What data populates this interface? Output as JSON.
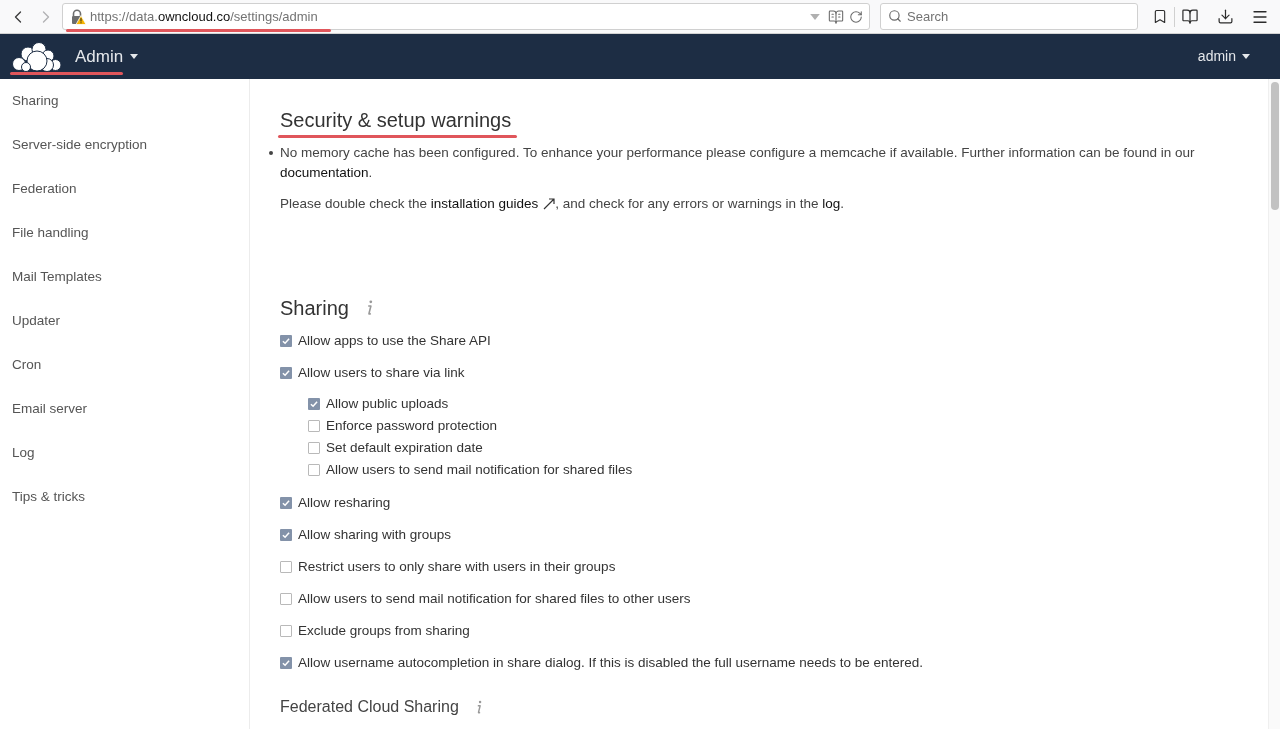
{
  "browser": {
    "navigation": [
      {
        "kind": "back",
        "disabled": false
      },
      {
        "kind": "forward",
        "disabled": true
      }
    ],
    "url": "https://data.**owncloud.co**/settings/admin",
    "search": {
      "placeholder": "Search"
    }
  },
  "header": {
    "app_name": "Admin",
    "user": "admin"
  },
  "sidebar": {
    "items": [
      {
        "label": "Sharing"
      },
      {
        "label": "Server-side encryption"
      },
      {
        "label": "Federation"
      },
      {
        "label": "File handling"
      },
      {
        "label": "Mail Templates"
      },
      {
        "label": "Updater"
      },
      {
        "label": "Cron"
      },
      {
        "label": "Email server"
      },
      {
        "label": "Log"
      },
      {
        "label": "Tips & tricks"
      }
    ]
  },
  "warnings": {
    "title": "Security & setup warnings",
    "items": [
      {
        "segments": [
          {
            "kind": "text",
            "text": "No memory cache has been configured. To enhance your performance please configure a memcache if available. Further information can be found in our "
          },
          {
            "kind": "link",
            "text": "documentation",
            "external": false
          },
          {
            "kind": "text",
            "text": "."
          }
        ]
      }
    ],
    "note": {
      "segments": [
        {
          "kind": "text",
          "text": "Please double check the "
        },
        {
          "kind": "link",
          "text": "installation guides",
          "external": true
        },
        {
          "kind": "text",
          "text": ", and check for any errors or warnings in the "
        },
        {
          "kind": "link",
          "text": "log",
          "external": false
        },
        {
          "kind": "text",
          "text": "."
        }
      ]
    }
  },
  "sharing": {
    "title": "Sharing",
    "options": [
      {
        "label": "Allow apps to use the Share API",
        "checked": true
      },
      {
        "label": "Allow users to share via link",
        "checked": true,
        "children": [
          {
            "label": "Allow public uploads",
            "checked": true
          },
          {
            "label": "Enforce password protection",
            "checked": false
          },
          {
            "label": "Set default expiration date",
            "checked": false
          },
          {
            "label": "Allow users to send mail notification for shared files",
            "checked": false
          }
        ]
      },
      {
        "label": "Allow resharing",
        "checked": true
      },
      {
        "label": "Allow sharing with groups",
        "checked": true
      },
      {
        "label": "Restrict users to only share with users in their groups",
        "checked": false
      },
      {
        "label": "Allow users to send mail notification for shared files to other users",
        "checked": false
      },
      {
        "label": "Exclude groups from sharing",
        "checked": false
      },
      {
        "label": "Allow username autocompletion in share dialog. If this is disabled the full username needs to be entered.",
        "checked": true
      }
    ]
  },
  "federated_sharing": {
    "title": "Federated Cloud Sharing"
  }
}
